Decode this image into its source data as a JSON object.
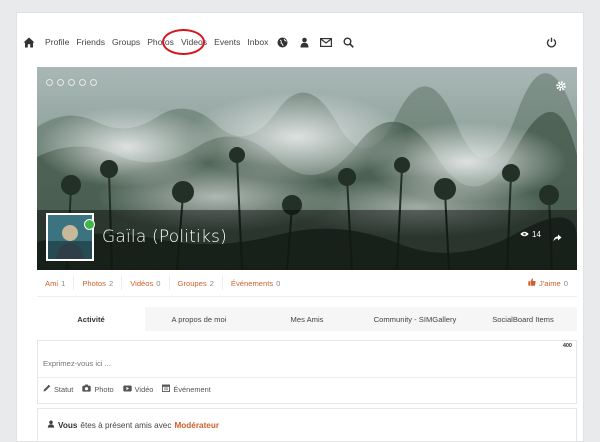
{
  "toolbar": {
    "nav": [
      "Profile",
      "Friends",
      "Groups",
      "Photos",
      "Videos",
      "Events",
      "Inbox"
    ],
    "icons": [
      "home-icon",
      "globe-icon",
      "user-icon",
      "envelope-icon",
      "search-icon",
      "power-icon"
    ]
  },
  "cover": {
    "name": "Gaïla (Politiks)",
    "views": "14"
  },
  "stats": [
    {
      "label": "Ami",
      "count": "1"
    },
    {
      "label": "Photos",
      "count": "2"
    },
    {
      "label": "Vidéos",
      "count": "0"
    },
    {
      "label": "Groupes",
      "count": "2"
    },
    {
      "label": "Événements",
      "count": "0"
    }
  ],
  "like": {
    "label": "J'aime",
    "count": "0"
  },
  "tabs": [
    "Activité",
    "A propos de moi",
    "Mes Amis",
    "Community - SIMGallery",
    "SocialBoard Items"
  ],
  "composer": {
    "placeholder": "Exprimez-vous ici ...",
    "char_count": "400",
    "actions": [
      "Statut",
      "Photo",
      "Vidéo",
      "Événement"
    ]
  },
  "activity": {
    "bold": "Vous",
    "text": "êtes à présent amis avec",
    "link": "Modérateur"
  },
  "colors": {
    "accent": "#d0612a",
    "highlight_circle": "#d4171f",
    "online": "#3fb64a"
  }
}
